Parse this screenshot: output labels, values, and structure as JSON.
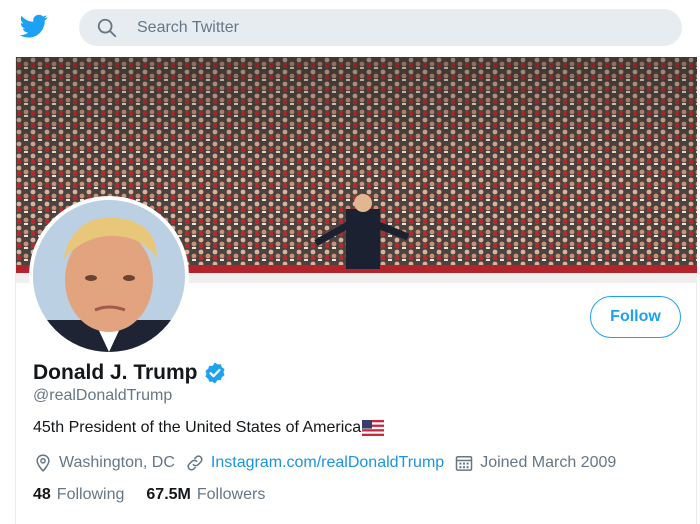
{
  "search": {
    "placeholder": "Search Twitter"
  },
  "profile": {
    "display_name": "Donald J. Trump",
    "handle": "@realDonaldTrump",
    "bio": "45th President of the United States of America",
    "location": "Washington, DC",
    "website": "Instagram.com/realDonaldTrump",
    "joined": "Joined March 2009",
    "following_count": "48",
    "following_label": "Following",
    "followers_count": "67.5M",
    "followers_label": "Followers"
  },
  "actions": {
    "follow_label": "Follow"
  },
  "icons": {
    "logo": "twitter-bird-icon",
    "search": "search-icon",
    "verified": "verified-badge-icon",
    "flag": "us-flag-icon",
    "location": "location-pin-icon",
    "link": "link-icon",
    "calendar": "calendar-icon"
  },
  "colors": {
    "brand": "#1da1f2",
    "link": "#1b95e0",
    "muted_text": "#657786",
    "search_bg": "#e6ecf0"
  }
}
